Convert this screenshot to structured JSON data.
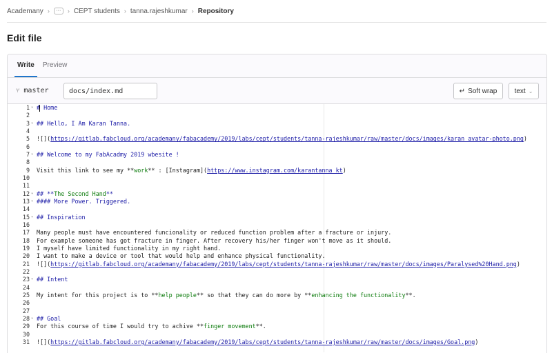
{
  "breadcrumb": {
    "root": "Academany",
    "more": "···",
    "group": "CEPT students",
    "user": "tanna.rajeshkumar",
    "current": "Repository"
  },
  "page": {
    "title": "Edit file"
  },
  "tabs": [
    {
      "label": "Write",
      "active": true
    },
    {
      "label": "Preview",
      "active": false
    }
  ],
  "toolbar": {
    "branch": "master",
    "file_path": "docs/index.md",
    "soft_wrap": "Soft wrap",
    "language": "text"
  },
  "editor": {
    "lines": [
      {
        "n": "1",
        "fold": true,
        "type": "heading",
        "text": "# Home"
      },
      {
        "n": "2",
        "text": ""
      },
      {
        "n": "3",
        "fold": true,
        "type": "heading",
        "text": "## Hello, I Am Karan Tanna."
      },
      {
        "n": "4",
        "text": ""
      },
      {
        "n": "5",
        "type": "link",
        "pre": "![](",
        "url": "https://gitlab.fabcloud.org/academany/fabacademy/2019/labs/cept/students/tanna-rajeshkumar/raw/master/docs/images/karan_avatar-photo.png",
        "post": ")"
      },
      {
        "n": "6",
        "text": ""
      },
      {
        "n": "7",
        "fold": true,
        "type": "heading",
        "text": "## Welcome to my FabAcadmy 2019 wbesite !"
      },
      {
        "n": "8",
        "text": ""
      },
      {
        "n": "9",
        "type": "mixed",
        "parts": [
          "Visit this link to see my **",
          "work",
          "** : [Instagram](",
          "https://www.instagram.com/karantanna_kt",
          ")"
        ]
      },
      {
        "n": "10",
        "text": ""
      },
      {
        "n": "11",
        "text": ""
      },
      {
        "n": "12",
        "fold": true,
        "type": "heading2",
        "parts": [
          "## **",
          "The Second Hand",
          "**"
        ]
      },
      {
        "n": "13",
        "fold": true,
        "type": "heading",
        "text": "#### More Power. Triggered."
      },
      {
        "n": "14",
        "text": ""
      },
      {
        "n": "15",
        "fold": true,
        "type": "heading",
        "text": "## Inspiration"
      },
      {
        "n": "16",
        "text": ""
      },
      {
        "n": "17",
        "text": "Many people must have encountered funcionality or reduced function problem after a fracture or injury."
      },
      {
        "n": "18",
        "text": "For example someone has got fracture in finger. After recovery his/her finger won't move as it should."
      },
      {
        "n": "19",
        "text": "I myself have limited functionality in my right hand."
      },
      {
        "n": "20",
        "text": "I want to make a device or tool that would help and enhance physical functionality."
      },
      {
        "n": "21",
        "type": "link",
        "pre": "![](",
        "url": "https://gitlab.fabcloud.org/academany/fabacademy/2019/labs/cept/students/tanna-rajeshkumar/raw/master/docs/images/Paralysed%20Hand.png",
        "post": ")"
      },
      {
        "n": "22",
        "text": ""
      },
      {
        "n": "23",
        "fold": true,
        "type": "heading",
        "text": "## Intent"
      },
      {
        "n": "24",
        "text": ""
      },
      {
        "n": "25",
        "type": "mixed3",
        "parts": [
          "My intent for this project is to **",
          "help people",
          "** so that they can do more by **",
          "enhancing the functionality",
          "**."
        ]
      },
      {
        "n": "26",
        "text": ""
      },
      {
        "n": "27",
        "text": ""
      },
      {
        "n": "28",
        "fold": true,
        "type": "heading",
        "text": "## Goal"
      },
      {
        "n": "29",
        "type": "mixed4",
        "parts": [
          "For this course of time I would try to achive **",
          "finger movement",
          "**."
        ]
      },
      {
        "n": "30",
        "text": ""
      },
      {
        "n": "31",
        "type": "link",
        "pre": "![](",
        "url": "https://gitlab.fabcloud.org/academany/fabacademy/2019/labs/cept/students/tanna-rajeshkumar/raw/master/docs/images/Goal.png",
        "post": ")"
      }
    ]
  }
}
